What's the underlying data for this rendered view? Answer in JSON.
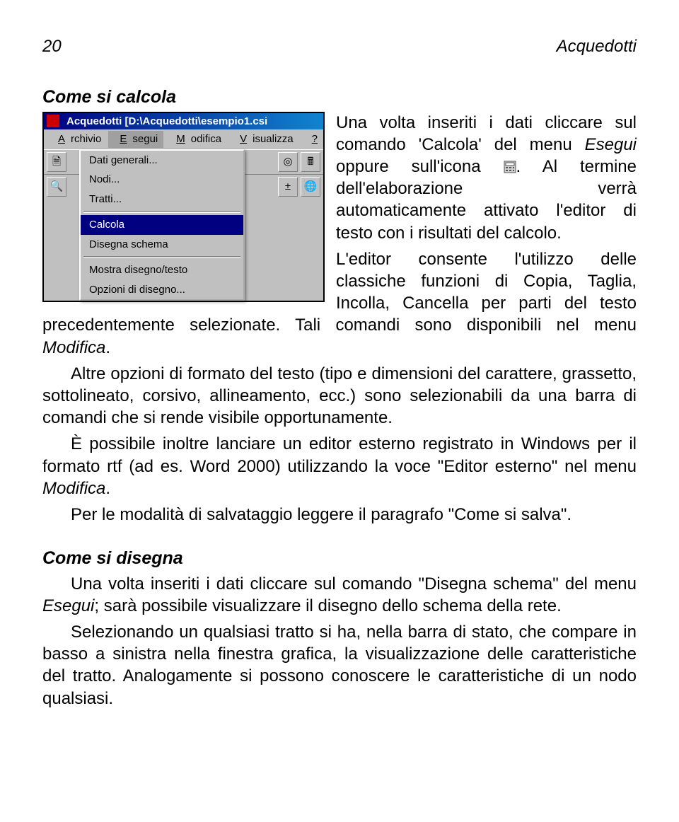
{
  "page": {
    "number": "20",
    "title": "Acquedotti"
  },
  "sections": {
    "calc": {
      "title": "Come si calcola"
    },
    "draw": {
      "title": "Come si disegna"
    }
  },
  "text": {
    "p1a": "Una volta inseriti i dati cliccare sul comando 'Calcola' del menu ",
    "p1b_em": "Esegui",
    "p1c": " oppure sull'icona ",
    "p1d": ". Al termine dell'elaborazione verrà automaticamente attivato l'editor di testo con i risultati del calcolo.",
    "p2a": "L'editor consente l'utilizzo delle classiche funzioni di Copia, Taglia, Incolla, Cancella per parti del testo precedentemente selezionate. Tali comandi sono disponibili nel menu ",
    "p2_em": "Modifica",
    "p2b": ".",
    "p3": "Altre opzioni di formato del testo (tipo e dimensioni del carattere, grassetto, sottolineato, corsivo, allineamento, ecc.) sono selezionabili da una barra di comandi che si rende visibile opportunamente.",
    "p4a": "È possibile inoltre lanciare un editor esterno registrato in Windows per il formato rtf (ad es. Word 2000) utilizzando la voce \"Editor esterno\" nel menu ",
    "p4_em": "Modifica",
    "p4b": ".",
    "p5": "Per le modalità di salvataggio leggere il paragrafo \"Come si salva\".",
    "d1a": "Una volta inseriti i dati cliccare sul comando \"Disegna schema\" del menu ",
    "d1_em": "Esegui",
    "d1b": "; sarà possibile visualizzare il disegno dello schema della rete.",
    "d2": "Selezionando un qualsiasi tratto si ha, nella barra di stato, che compare in basso a sinistra nella finestra grafica, la visualizzazione delle caratteristiche del tratto. Analogamente si possono conoscere le caratteristiche di un nodo qualsiasi."
  },
  "screenshot": {
    "title": "Acquedotti [D:\\Acquedotti\\esempio1.csi",
    "menubar": [
      "Archivio",
      "Esegui",
      "Modifica",
      "Visualizza",
      "?"
    ],
    "dropdown": {
      "items": [
        "Dati generali...",
        "Nodi...",
        "Tratti...",
        "Calcola",
        "Disegna schema",
        "Mostra disegno/testo",
        "Opzioni di disegno..."
      ],
      "separators_after": [
        2,
        4
      ],
      "selected_index": 3
    },
    "toolbar_icons": [
      "new-file-icon",
      "open-file-icon",
      "save-icon",
      "target-icon",
      "calc-icon"
    ],
    "toolbar2_icons": [
      "zoom-in-icon",
      "zoom-out-icon",
      "zoom-fit-icon",
      "add-node-icon",
      "globe-icon"
    ]
  }
}
